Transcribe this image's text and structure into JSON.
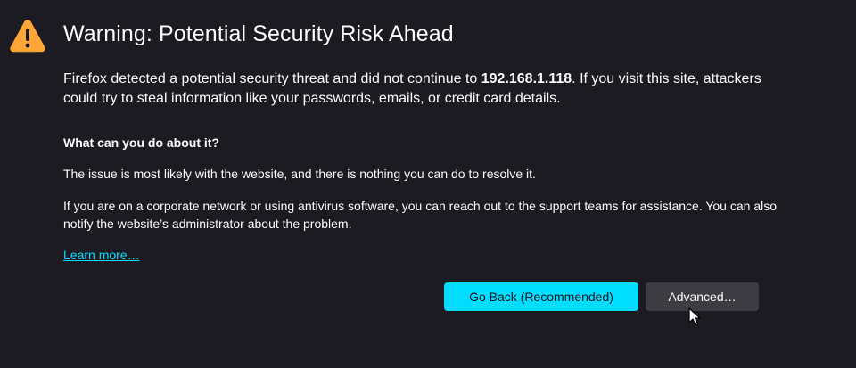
{
  "page": {
    "title": "Warning: Potential Security Risk Ahead",
    "intro_before_host": "Firefox detected a potential security threat and did not continue to ",
    "host": "192.168.1.118",
    "intro_after_host": ". If you visit this site, attackers could try to steal information like your passwords, emails, or credit card details.",
    "section_heading": "What can you do about it?",
    "paragraph_1": "The issue is most likely with the website, and there is nothing you can do to resolve it.",
    "paragraph_2": "If you are on a corporate network or using antivirus software, you can reach out to the support teams for assistance. You can also notify the website’s administrator about the problem.",
    "learn_more_label": "Learn more…"
  },
  "buttons": {
    "go_back_label": "Go Back (Recommended)",
    "advanced_label": "Advanced…"
  },
  "icons": {
    "warning": "warning-triangle-icon",
    "cursor": "mouse-pointer-icon"
  },
  "colors": {
    "background": "#1c1b22",
    "text": "#fbfbfe",
    "accent": "#00ddff",
    "warning_icon": "#ffa436",
    "secondary_button": "#3d3c43"
  }
}
